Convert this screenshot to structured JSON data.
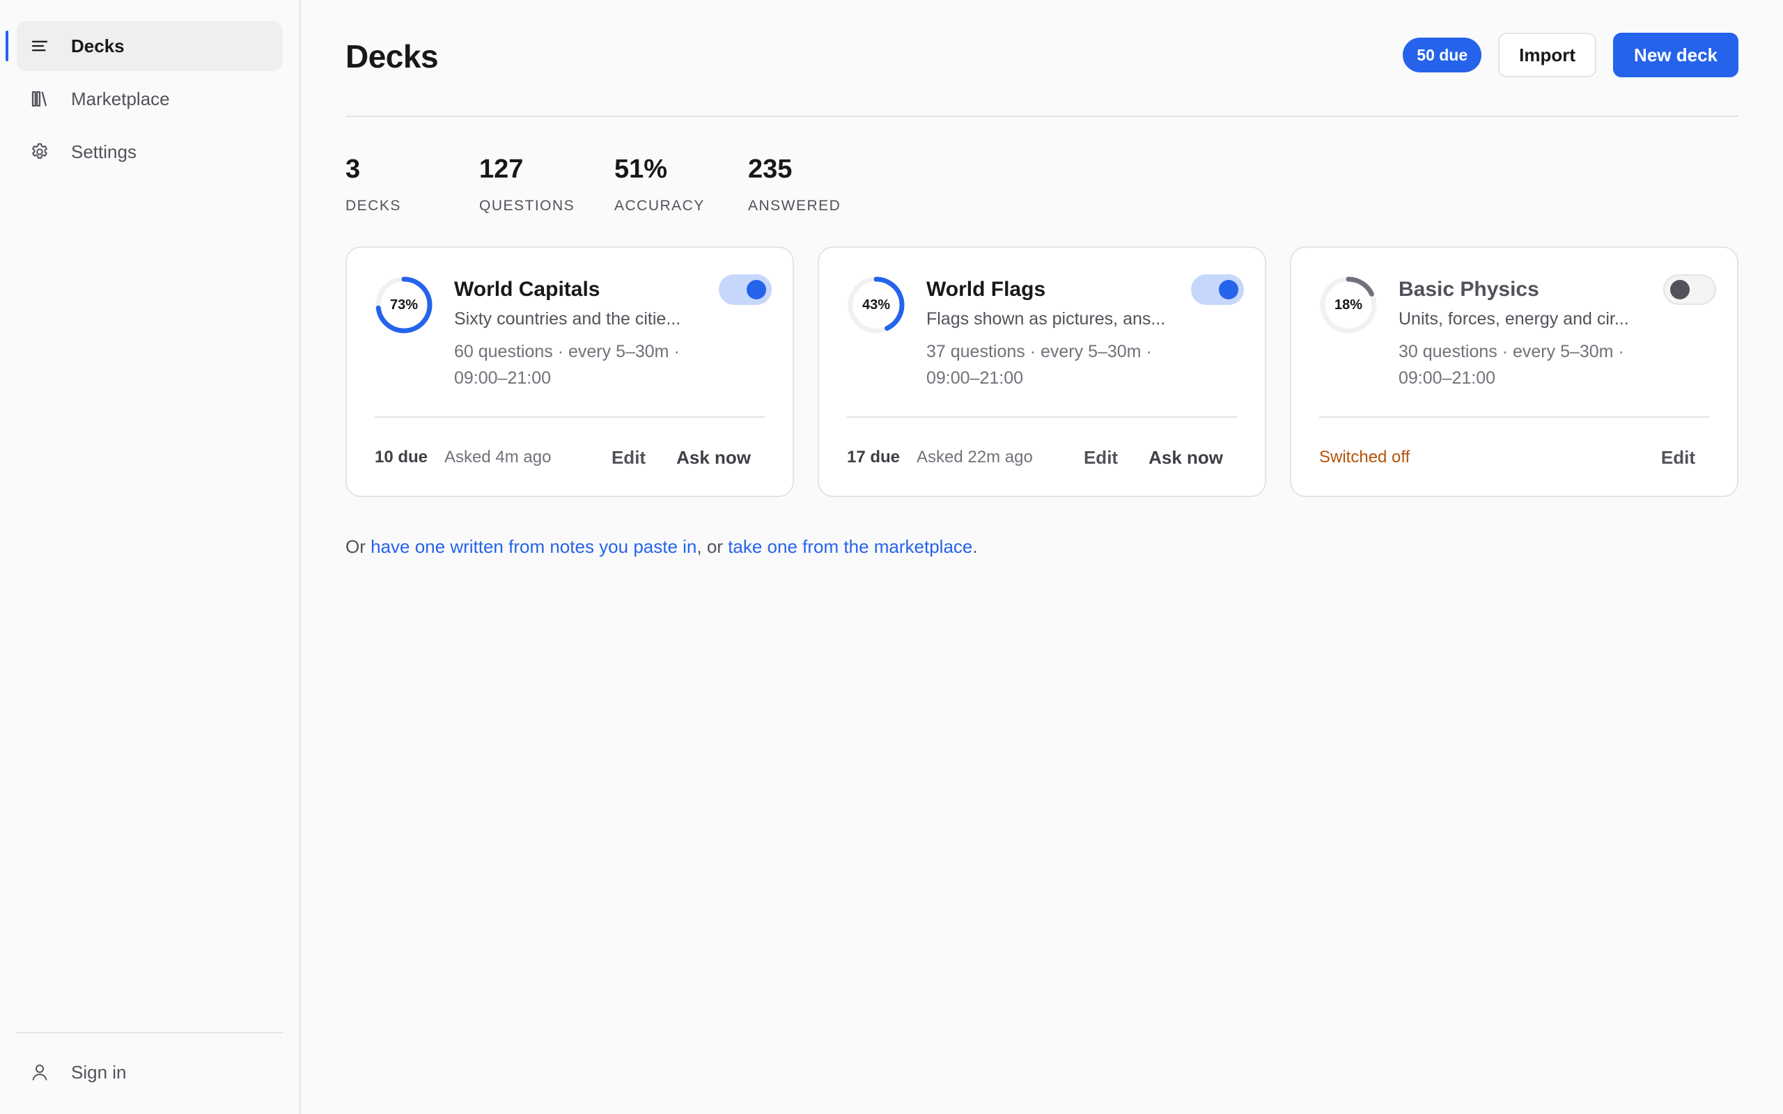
{
  "sidebar": {
    "items": [
      {
        "label": "Decks",
        "icon": "menu-lines-icon",
        "active": true
      },
      {
        "label": "Marketplace",
        "icon": "library-icon",
        "active": false
      },
      {
        "label": "Settings",
        "icon": "gear-icon",
        "active": false
      }
    ],
    "footer": {
      "label": "Sign in",
      "icon": "user-icon"
    }
  },
  "header": {
    "title": "Decks",
    "due_badge": "50 due",
    "import_label": "Import",
    "new_deck_label": "New deck"
  },
  "stats": [
    {
      "value": "3",
      "label": "DECKS"
    },
    {
      "value": "127",
      "label": "QUESTIONS"
    },
    {
      "value": "51%",
      "label": "ACCURACY"
    },
    {
      "value": "235",
      "label": "ANSWERED"
    }
  ],
  "decks": [
    {
      "title": "World Capitals",
      "description": "Sixty countries and the citie...",
      "meta_line1": "60 questions · every 5–30m ·",
      "meta_line2": "09:00–21:00",
      "progress_label": "73%",
      "progress": 0.73,
      "enabled": true,
      "due": "10 due",
      "asked": "Asked 4m ago",
      "edit_label": "Edit",
      "ask_label": "Ask now"
    },
    {
      "title": "World Flags",
      "description": "Flags shown as pictures, ans...",
      "meta_line1": "37 questions · every 5–30m ·",
      "meta_line2": "09:00–21:00",
      "progress_label": "43%",
      "progress": 0.43,
      "enabled": true,
      "due": "17 due",
      "asked": "Asked 22m ago",
      "edit_label": "Edit",
      "ask_label": "Ask now"
    },
    {
      "title": "Basic Physics",
      "description": "Units, forces, energy and cir...",
      "meta_line1": "30 questions · every 5–30m ·",
      "meta_line2": "09:00–21:00",
      "progress_label": "18%",
      "progress": 0.18,
      "enabled": false,
      "status": "Switched off",
      "edit_label": "Edit"
    }
  ],
  "footer_note": {
    "prefix": "Or ",
    "link1": "have one written from notes you paste in",
    "middle": ", or ",
    "link2": "take one from the marketplace",
    "suffix": "."
  },
  "colors": {
    "accent": "#2563eb",
    "accent_soft": "#c7d7fb",
    "off_ring": "#71717a",
    "warning": "#b45309"
  }
}
